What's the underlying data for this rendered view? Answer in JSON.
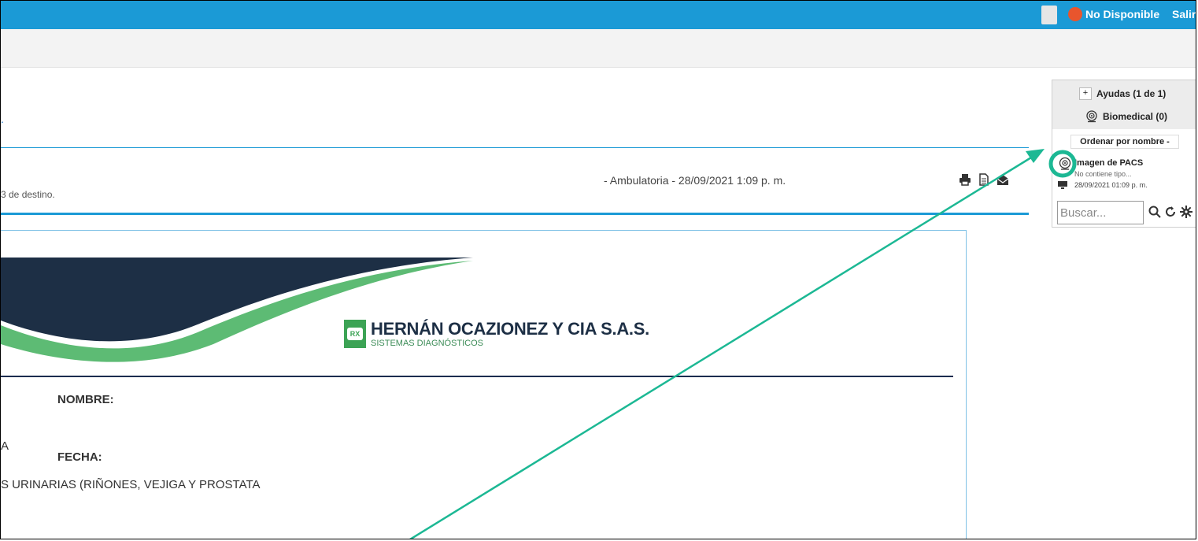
{
  "topbar": {
    "status_text": "No Disponible",
    "logout_label": "Salir",
    "status_color": "#e8552d",
    "bar_color": "#1b9ad6"
  },
  "page": {
    "title_fragment": ".",
    "study_info": "- Ambulatoria - 28/09/2021 1:09 p. m.",
    "destination_text": "3 de destino."
  },
  "toolbar": {
    "icons": [
      "print-icon",
      "document-icon",
      "envelope-open-icon"
    ]
  },
  "report": {
    "company_name": "HERNÁN OCAZIONEZ Y CIA S.A.S.",
    "company_subtitle": "SISTEMAS DIAGNÓSTICOS",
    "logo_text": "RX",
    "name_label": "NOMBRE:",
    "date_label": "FECHA:",
    "fragment_a": "A",
    "study_line": "S URINARIAS (RIÑONES, VEJIGA Y PROSTATA",
    "brand_dark": "#1d2f45",
    "brand_green": "#5dbb74"
  },
  "side_panel": {
    "ayudas_label": "Ayudas (1 de 1)",
    "biomedical_label": "Biomedical (0)",
    "sort_label": "Ordenar por nombre -",
    "item_title": "Imagen de PACS",
    "item_subtitle": "No contiene tipo...",
    "item_date": "28/09/2021 01:09 p. m.",
    "search_placeholder": "Buscar...",
    "highlight_color": "#1cb894"
  }
}
